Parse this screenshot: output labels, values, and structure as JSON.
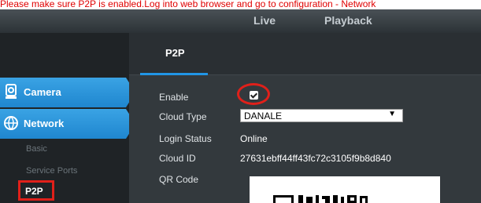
{
  "caption": "Please make sure P2P is enabled.Log into web browser and go to configuration - Network",
  "topnav": {
    "live": "Live",
    "playback": "Playback"
  },
  "sidebar": {
    "items": [
      {
        "label": "Camera",
        "icon": "camera-icon"
      },
      {
        "label": "Network",
        "icon": "network-icon"
      }
    ],
    "subitems": [
      "Basic",
      "Service Ports",
      "P2P"
    ]
  },
  "tab": {
    "label": "P2P"
  },
  "form": {
    "enable_label": "Enable",
    "enable_checked": true,
    "cloud_type_label": "Cloud Type",
    "cloud_type_value": "DANALE",
    "login_status_label": "Login Status",
    "login_status_value": "Online",
    "cloud_id_label": "Cloud ID",
    "cloud_id_value": "27631ebff44ff43fc72c3105f9b8d840",
    "qr_code_label": "QR Code"
  },
  "colors": {
    "accent": "#2196e6",
    "highlight": "#e0201a",
    "caption": "#e00000"
  }
}
